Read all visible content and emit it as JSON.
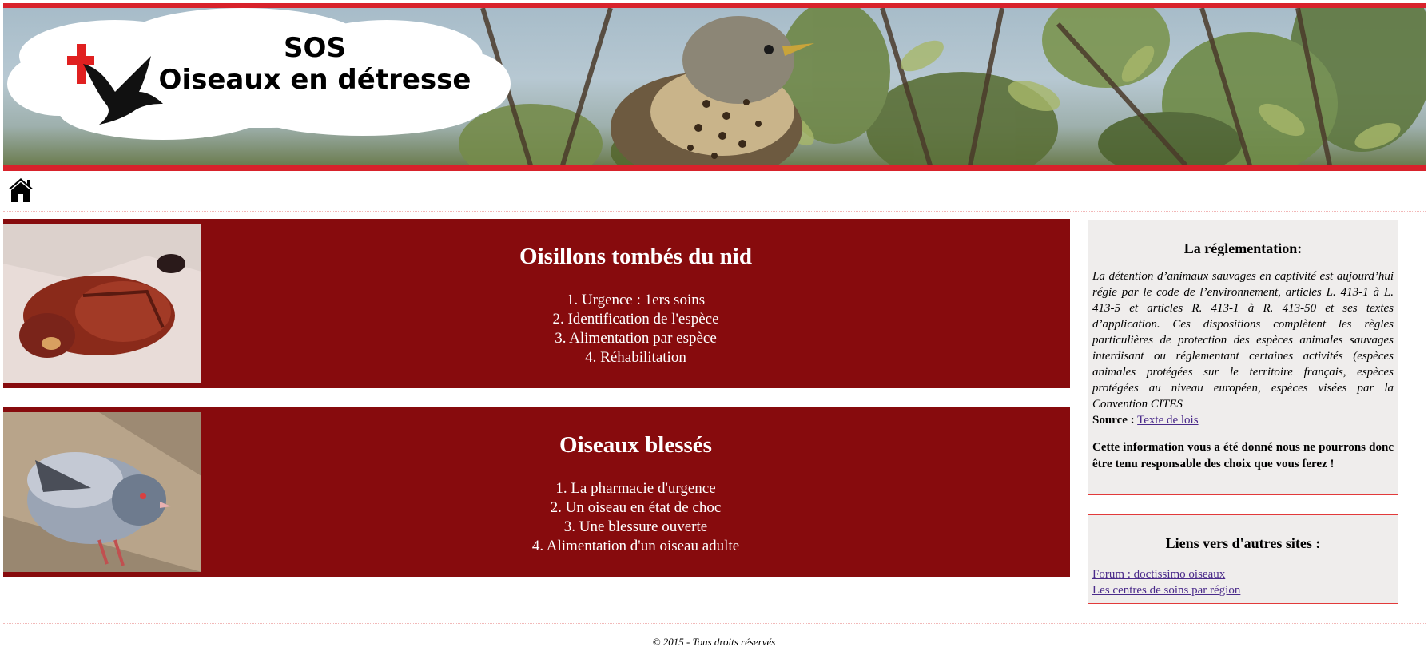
{
  "header": {
    "title_line1": "SOS",
    "title_line2": "Oiseaux en détresse",
    "logo_icons": [
      "red-cross-icon",
      "bird-silhouette-icon"
    ],
    "banner_color": "#d8222b"
  },
  "nav": {
    "home_icon": "home-icon"
  },
  "cards": [
    {
      "title": "Oisillons tombés du nid",
      "items": [
        "1. Urgence : 1ers soins",
        "2. Identification de l'espèce",
        "3. Alimentation par espèce",
        "4. Réhabilitation"
      ]
    },
    {
      "title": "Oiseaux blessés",
      "items": [
        "1. La pharmacie d'urgence",
        "2. Un oiseau en état de choc",
        "3. Une blessure ouverte",
        "4. Alimentation d'un oiseau adulte"
      ]
    }
  ],
  "card_color": "#870b0d",
  "sidebar": {
    "regulation": {
      "title": "La réglementation:",
      "text": "La détention d’animaux sauvages en captivité est aujourd’hui régie par le code de l’environnement, articles L. 413-1 à L. 413-5 et articles R. 413-1 à R. 413-50 et ses textes d’application. Ces dispositions complètent les règles particulières de protection des espèces animales sauvages interdisant ou réglementant certaines activités (espèces animales protégées sur le territoire français, espèces protégées au niveau européen, espèces visées par la Convention CITES",
      "source_label": "Source :",
      "source_link": "Texte de lois",
      "disclaimer": "Cette information vous a été donné nous ne pourrons donc être tenu responsable des choix que vous ferez !"
    },
    "links": {
      "title": "Liens vers d'autres sites :",
      "items": [
        "Forum : doctissimo oiseaux",
        "Les centres de soins par région"
      ]
    }
  },
  "footer": {
    "text": "© 2015 - Tous droits réservés"
  }
}
